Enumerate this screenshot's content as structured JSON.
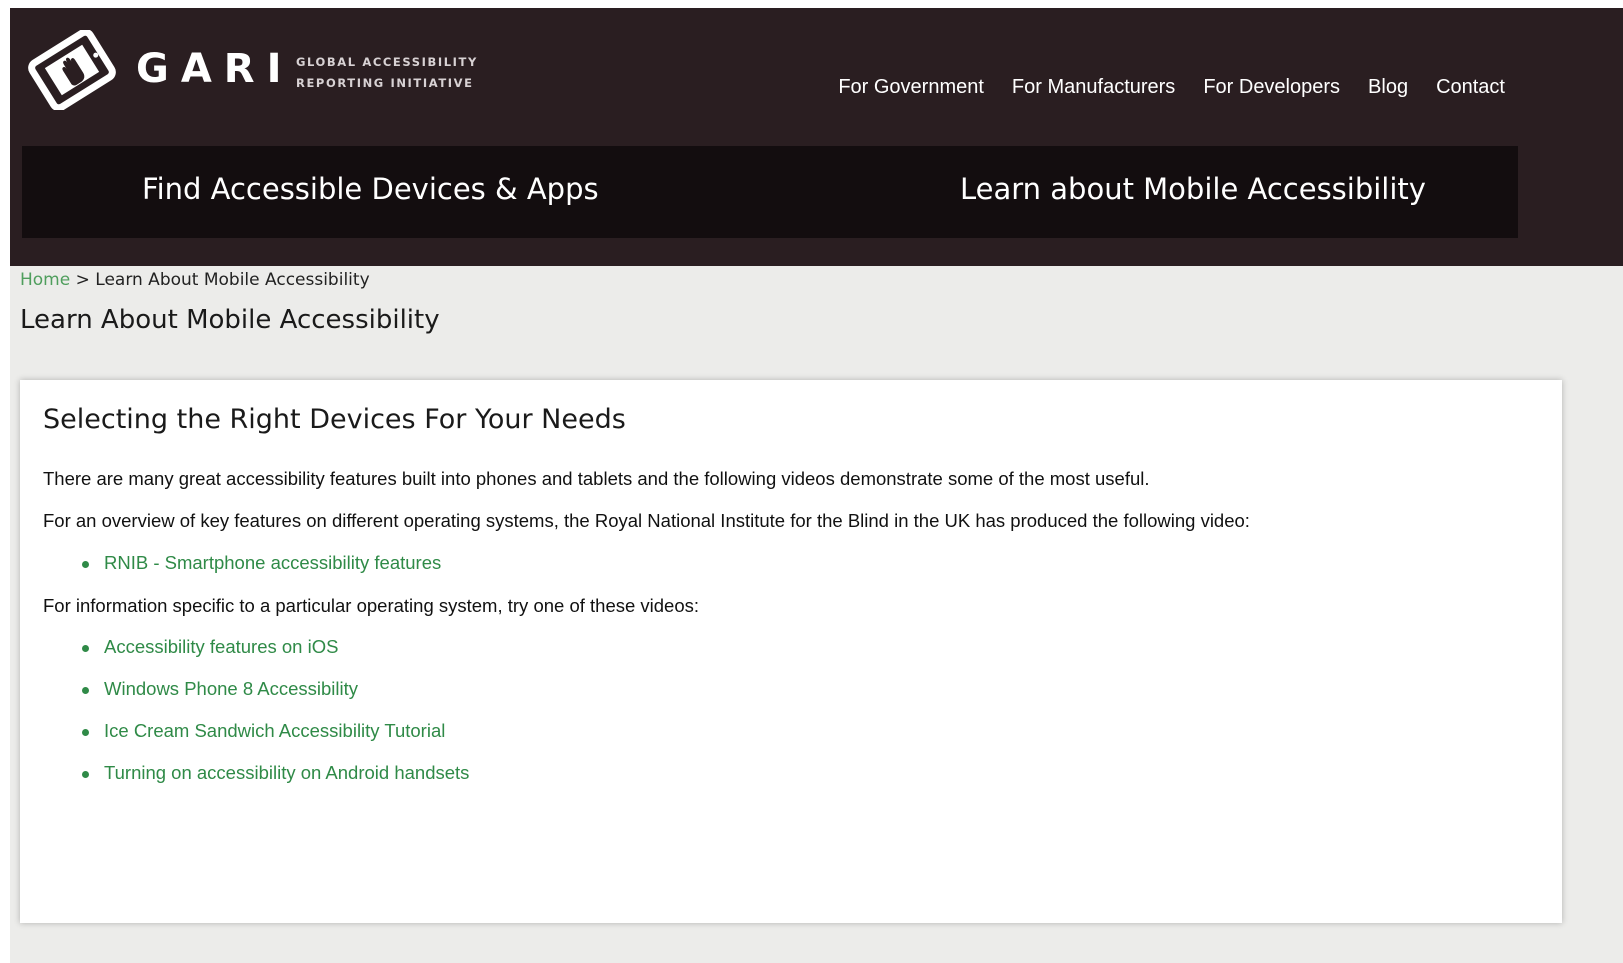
{
  "header": {
    "logo_text": "GARI",
    "logo_tagline_line1": "GLOBAL ACCESSIBILITY",
    "logo_tagline_line2": "REPORTING INITIATIVE",
    "top_nav": [
      {
        "label": "For Government"
      },
      {
        "label": "For Manufacturers"
      },
      {
        "label": "For Developers"
      },
      {
        "label": "Blog"
      },
      {
        "label": "Contact"
      }
    ],
    "main_nav": [
      {
        "label": "Find Accessible Devices & Apps"
      },
      {
        "label": "Learn about Mobile Accessibility"
      }
    ]
  },
  "breadcrumb": {
    "home": "Home",
    "separator": ">",
    "current": "Learn About Mobile Accessibility"
  },
  "page_title": "Learn About Mobile Accessibility",
  "content": {
    "heading": "Selecting the Right Devices For Your Needs",
    "intro": "There are many great accessibility features built into phones and tablets and the following videos demonstrate some of the most useful.",
    "overview": "For an overview of key features on different operating systems, the Royal National Institute for the Blind in the UK has produced the following video:",
    "overview_links": [
      {
        "label": "RNIB - Smartphone accessibility features"
      }
    ],
    "specific": "For information specific to a particular operating system, try one of these videos:",
    "os_links": [
      {
        "label": "Accessibility features on iOS"
      },
      {
        "label": "Windows Phone 8 Accessibility"
      },
      {
        "label": "Ice Cream Sandwich Accessibility Tutorial"
      },
      {
        "label": "Turning on accessibility on Android handsets"
      }
    ]
  },
  "colors": {
    "header_bg": "#2a1e21",
    "main_nav_bg": "#130d0f",
    "link_green": "#2f8a47",
    "breadcrumb_green": "#4f9e5d",
    "page_bg": "#ececea"
  }
}
